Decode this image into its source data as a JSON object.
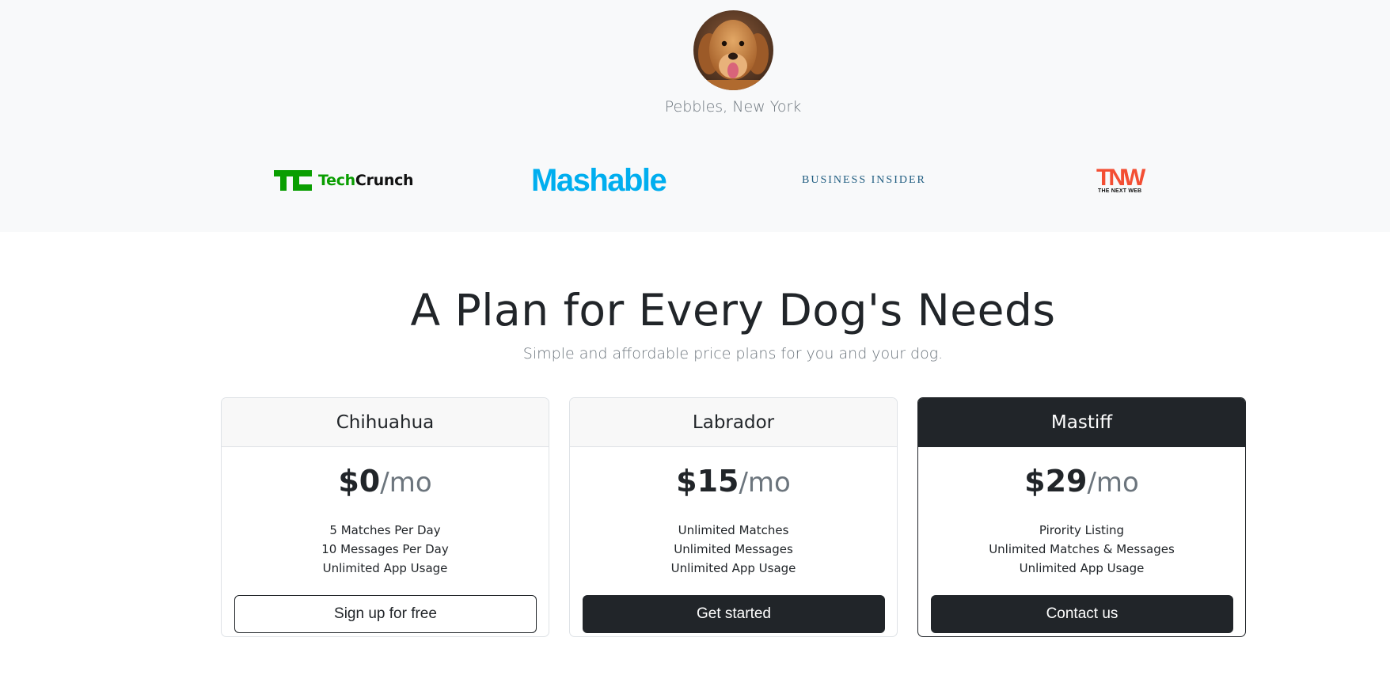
{
  "testimonial": {
    "author": "Pebbles, New York"
  },
  "press": {
    "logos": [
      {
        "name": "TechCrunch",
        "text_green": "Tech",
        "text_black": "Crunch",
        "color": "#0a9e01"
      },
      {
        "name": "Mashable",
        "text": "Mashable",
        "color": "#00aeef"
      },
      {
        "name": "Business Insider",
        "text": "BUSINESS INSIDER",
        "color": "#1f5c80"
      },
      {
        "name": "The Next Web",
        "text": "TNW",
        "subtext": "THE NEXT WEB",
        "color": "#f34e33"
      }
    ]
  },
  "pricing": {
    "title": "A Plan for Every Dog's Needs",
    "subtitle": "Simple and affordable price plans for you and your dog.",
    "plans": [
      {
        "name": "Chihuahua",
        "price": "$0",
        "unit": "/mo",
        "features": [
          "5 Matches Per Day",
          "10 Messages Per Day",
          "Unlimited App Usage"
        ],
        "cta": "Sign up for free"
      },
      {
        "name": "Labrador",
        "price": "$15",
        "unit": "/mo",
        "features": [
          "Unlimited Matches",
          "Unlimited Messages",
          "Unlimited App Usage"
        ],
        "cta": "Get started"
      },
      {
        "name": "Mastiff",
        "price": "$29",
        "unit": "/mo",
        "features": [
          "Pirority Listing",
          "Unlimited Matches & Messages",
          "Unlimited App Usage"
        ],
        "cta": "Contact us"
      }
    ]
  },
  "colors": {
    "band_background": "#f8f9fa",
    "dark": "#212529",
    "muted": "#6c757d"
  }
}
